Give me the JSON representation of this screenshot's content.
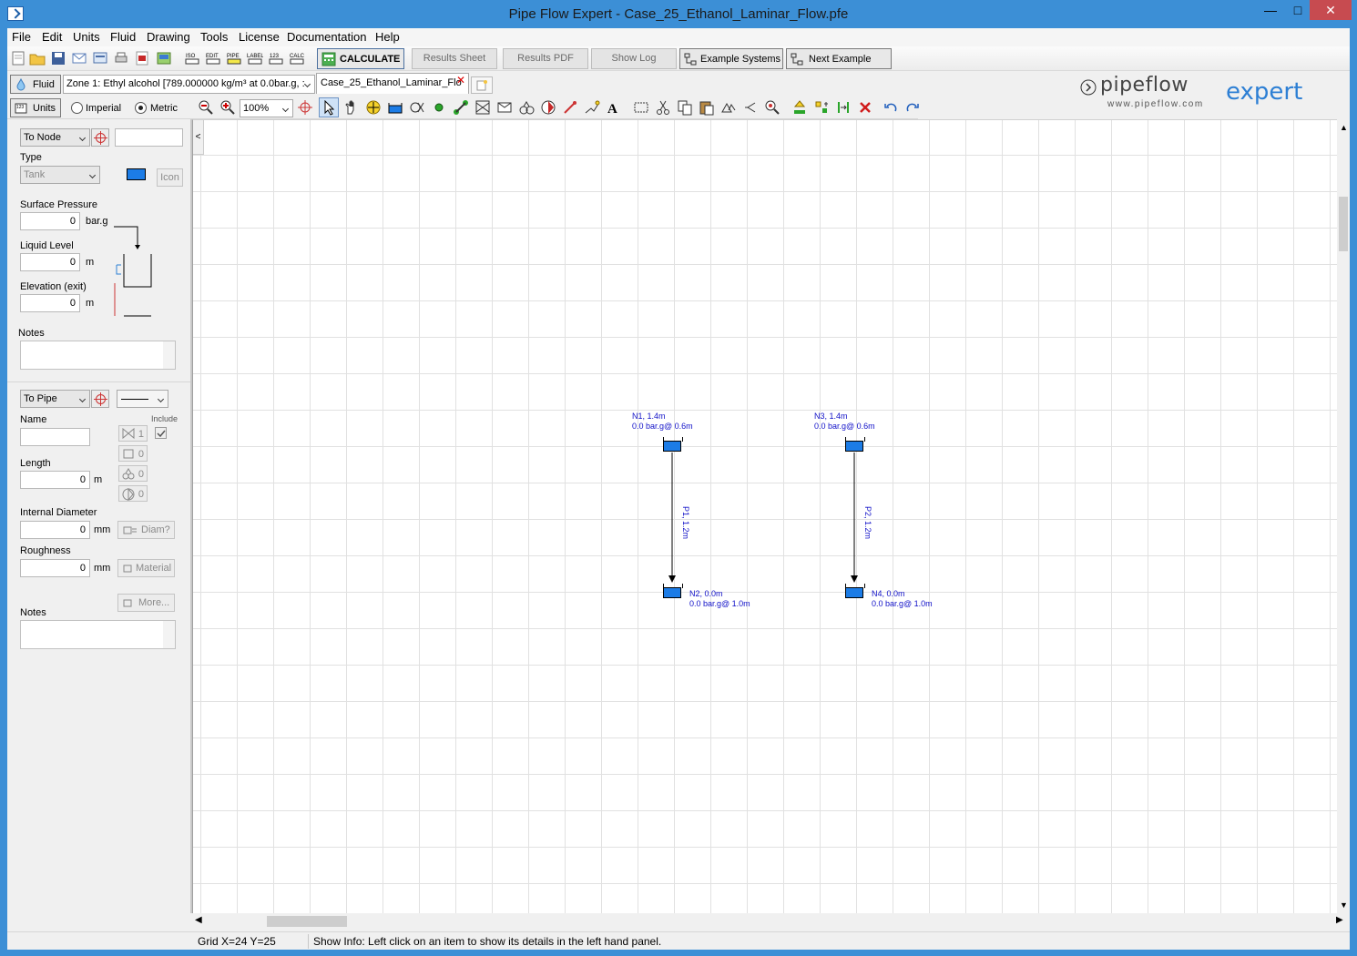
{
  "window": {
    "title": "Pipe Flow Expert - Case_25_Ethanol_Laminar_Flow.pfe"
  },
  "menu": [
    "File",
    "Edit",
    "Units",
    "Fluid",
    "Drawing",
    "Tools",
    "License",
    "Documentation",
    "Help"
  ],
  "toolbar": {
    "calculate": "CALCULATE",
    "results_sheet": "Results Sheet",
    "results_pdf": "Results PDF",
    "show_log": "Show Log",
    "example_systems": "Example Systems",
    "next_example": "Next Example"
  },
  "fluid_bar": {
    "fluid_button": "Fluid",
    "zone": "Zone 1: Ethyl alcohol [789.000000 kg/m³ at 0.0bar.g, :",
    "tab": "Case_25_Ethanol_Laminar_Flo"
  },
  "units_bar": {
    "units_button": "Units",
    "imperial": "Imperial",
    "metric": "Metric",
    "zoom": "100%"
  },
  "logo": {
    "brand": "pipeflow",
    "product": "expert",
    "url": "www.pipeflow.com"
  },
  "node_panel": {
    "selector": "To Node",
    "type_label": "Type",
    "type_value": "Tank",
    "icon_button": "Icon",
    "surface_pressure_label": "Surface Pressure",
    "surface_pressure_value": "0",
    "surface_pressure_unit": "bar.g",
    "liquid_level_label": "Liquid Level",
    "liquid_level_value": "0",
    "liquid_level_unit": "m",
    "elevation_label": "Elevation (exit)",
    "elevation_value": "0",
    "elevation_unit": "m",
    "notes_label": "Notes"
  },
  "pipe_panel": {
    "selector": "To Pipe",
    "include_label": "Include",
    "name_label": "Name",
    "length_label": "Length",
    "length_value": "0",
    "length_unit": "m",
    "diameter_label": "Internal Diameter",
    "diameter_value": "0",
    "diameter_unit": "mm",
    "diam_button": "Diam?",
    "roughness_label": "Roughness",
    "roughness_value": "0",
    "roughness_unit": "mm",
    "material_button": "Material",
    "more_button": "More...",
    "notes_label": "Notes",
    "count_fittings": "1",
    "count_components": "0",
    "count_valves": "0",
    "count_pumps": "0"
  },
  "diagram": {
    "nodes": [
      {
        "id": "N1",
        "line1": "N1, 1.4m",
        "line2": "0.0 bar.g@ 0.6m"
      },
      {
        "id": "N2",
        "line1": "N2, 0.0m",
        "line2": "0.0 bar.g@ 1.0m"
      },
      {
        "id": "N3",
        "line1": "N3, 1.4m",
        "line2": "0.0 bar.g@ 0.6m"
      },
      {
        "id": "N4",
        "line1": "N4, 0.0m",
        "line2": "0.0 bar.g@ 1.0m"
      }
    ],
    "pipes": [
      {
        "id": "P1",
        "label": "P1, 1.2m"
      },
      {
        "id": "P2",
        "label": "P2, 1.2m"
      }
    ]
  },
  "status": {
    "grid": "Grid  X=24  Y=25",
    "info": "Show Info: Left click on an item to show its details in the left hand panel."
  }
}
